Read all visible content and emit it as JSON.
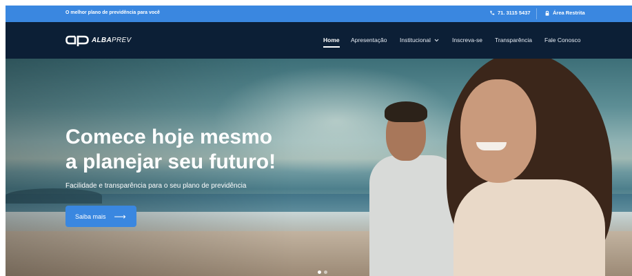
{
  "topbar": {
    "tagline": "O melhor plano de previdência para você",
    "phone": "71. 3115 5437",
    "restricted_area": "Área Restrita"
  },
  "brand": {
    "logo_mark": "ap",
    "name_bold": "ALBA",
    "name_light": "PREV"
  },
  "nav": {
    "items": [
      {
        "label": "Home",
        "active": true
      },
      {
        "label": "Apresentação"
      },
      {
        "label": "Institucional",
        "has_dropdown": true
      },
      {
        "label": "Inscreva-se"
      },
      {
        "label": "Transparência"
      },
      {
        "label": "Fale Conosco"
      }
    ]
  },
  "hero": {
    "headline_line1": "Comece hoje mesmo",
    "headline_line2": "a planejar seu futuro!",
    "subline": "Facilidade e transparência para o seu plano de previdência",
    "cta_label": "Saiba mais",
    "slides_total": 2,
    "slide_active": 1
  },
  "colors": {
    "topbar": "#3a87e0",
    "navbar": "#0c1f36",
    "cta": "#3a87e0"
  },
  "icons": {
    "phone": "phone-icon",
    "lock": "lock-icon",
    "dropdown": "chevron-down-icon",
    "cta_arrow": "arrow-right-icon"
  }
}
